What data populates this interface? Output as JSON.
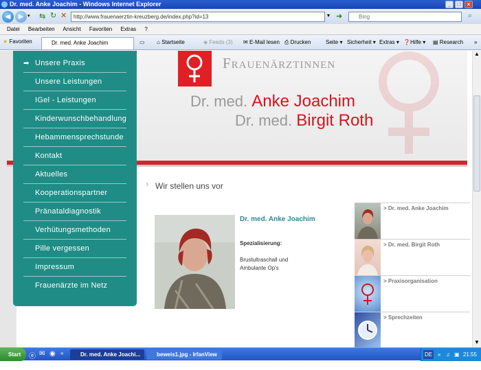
{
  "window": {
    "title": "Dr. med. Anke Joachim - Windows Internet Explorer"
  },
  "browser": {
    "url": "http://www.frauenaerztin-kreuzberg.de/index.php?id=13",
    "search_placeholder": "Bing",
    "menu": [
      "Datei",
      "Bearbeiten",
      "Ansicht",
      "Favoriten",
      "Extras",
      "?"
    ],
    "favorites_label": "Favoriten",
    "tab_title": "Dr. med. Anke Joachim",
    "commands": {
      "start": "Startseite",
      "feeds": "Feeds (3)",
      "mail": "E-Mail lesen",
      "print": "Drucken",
      "page": "Seite",
      "safety": "Sicherheit",
      "extras": "Extras",
      "help": "Hilfe",
      "research": "Research"
    }
  },
  "site": {
    "brand": "Frauenärztinnen",
    "doctor1_prefix": "Dr. med.",
    "doctor1_name": "Anke Joachim",
    "doctor2_prefix": "Dr. med.",
    "doctor2_name": "Birgit Roth",
    "nav": [
      "Unsere Praxis",
      "Unsere Leistungen",
      "IGel - Leistungen",
      "Kinderwunschbehandlung",
      "Hebammensprechstunde",
      "Kontakt",
      "Aktuelles",
      "Kooperationspartner",
      "Pränataldiagnostik",
      "Verhütungsmethoden",
      "Pille vergessen",
      "Impressum",
      "Frauenärzte im Netz"
    ],
    "heading": "Wir stellen uns vor",
    "profile": {
      "name": "Dr. med. Anke Joachim",
      "spec_label": "Spezialisierung:",
      "spec_line1": "Brustultraschall und",
      "spec_line2": "Ambulante Op's"
    },
    "right_links": [
      "> Dr. med. Anke Joachim",
      "> Dr. med. Birgit Roth",
      "> Praxisorganisation",
      "> Sprechzeiten"
    ],
    "accent_red": "#d3141f",
    "accent_teal": "#1f8c86"
  },
  "taskbar": {
    "start": "Start",
    "task1": "Dr. med. Anke Joachi...",
    "task2": "beweis1.jpg - IrfanView ...",
    "lang": "DE",
    "clock": "21:55"
  }
}
